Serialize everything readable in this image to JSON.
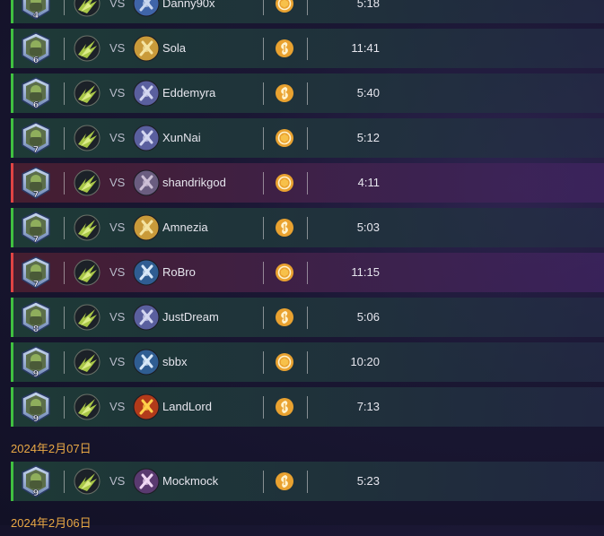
{
  "vs_label": "VS",
  "colors": {
    "win": "#40c040",
    "loss": "#e04444",
    "date": "#e9a845",
    "medal": "#e9a230"
  },
  "games": [
    {
      "rank": "4",
      "result": "win",
      "opponent": "Danny90x",
      "opponent_icon": "shield-blue-icon",
      "medal": "coin-icon",
      "time": "5:18"
    },
    {
      "rank": "6",
      "result": "win",
      "opponent": "Sola",
      "opponent_icon": "paladin-gold-icon",
      "medal": "swirl-icon",
      "time": "11:41"
    },
    {
      "rank": "6",
      "result": "win",
      "opponent": "Eddemyra",
      "opponent_icon": "hero-mage-icon",
      "medal": "swirl-icon",
      "time": "5:40"
    },
    {
      "rank": "7",
      "result": "win",
      "opponent": "XunNai",
      "opponent_icon": "hero-mage-icon",
      "medal": "coin-icon",
      "time": "5:12"
    },
    {
      "rank": "7",
      "result": "loss",
      "opponent": "shandrikgod",
      "opponent_icon": "hero-warrior-icon",
      "medal": "coin-icon",
      "time": "4:11"
    },
    {
      "rank": "7",
      "result": "win",
      "opponent": "Amnezia",
      "opponent_icon": "paladin-gold-icon",
      "medal": "swirl-icon",
      "time": "5:03"
    },
    {
      "rank": "7",
      "result": "loss",
      "opponent": "RoBro",
      "opponent_icon": "sword-blue-icon",
      "medal": "coin-icon",
      "time": "11:15"
    },
    {
      "rank": "8",
      "result": "win",
      "opponent": "JustDream",
      "opponent_icon": "hero-mage-icon",
      "medal": "swirl-icon",
      "time": "5:06"
    },
    {
      "rank": "9",
      "result": "win",
      "opponent": "sbbx",
      "opponent_icon": "sword-blue-icon",
      "medal": "coin-icon",
      "time": "10:20"
    },
    {
      "rank": "9",
      "result": "win",
      "opponent": "LandLord",
      "opponent_icon": "fire-icon",
      "medal": "swirl-icon",
      "time": "7:13"
    },
    {
      "date": "2024年2月07日"
    },
    {
      "rank": "9",
      "result": "win",
      "opponent": "Mockmock",
      "opponent_icon": "rogue-swirl-icon",
      "medal": "swirl-icon",
      "time": "5:23"
    },
    {
      "date": "2024年2月06日"
    }
  ]
}
